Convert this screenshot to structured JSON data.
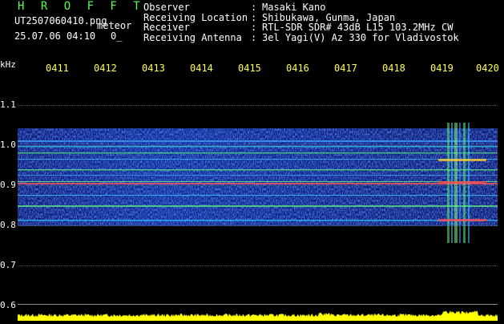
{
  "header": {
    "app_title": "H R O F F T",
    "file_name": "UT2507060410.png",
    "meteor_label": "meteor",
    "date_time": "25.07.06 04:10",
    "count_indicator": "0_"
  },
  "station_info": [
    {
      "key": "Observer",
      "sep": ":",
      "value": "Masaki Kano"
    },
    {
      "key": "Receiving Location",
      "sep": ":",
      "value": "Shibukawa, Gunma, Japan"
    },
    {
      "key": "Receiver",
      "sep": ":",
      "value": "RTL-SDR SDR# 43dB L15 103.2MHz CW"
    },
    {
      "key": "Receiving Antenna",
      "sep": ":",
      "value": "3el Yagi(V) Az 330 for Vladivostok"
    }
  ],
  "freq_unit": "kHz",
  "time_ticks": [
    "0411",
    "0412",
    "0413",
    "0414",
    "0415",
    "0416",
    "0417",
    "0418",
    "0419",
    "0420"
  ],
  "freq_ticks": [
    "1.1",
    "1.0",
    "0.9",
    "0.8",
    "0.7",
    "0.6"
  ],
  "colors": {
    "title_green": "#54ff54",
    "tick_yellow": "#ffff55",
    "amplitude_yellow": "#ffff00",
    "background": "#000000"
  }
}
